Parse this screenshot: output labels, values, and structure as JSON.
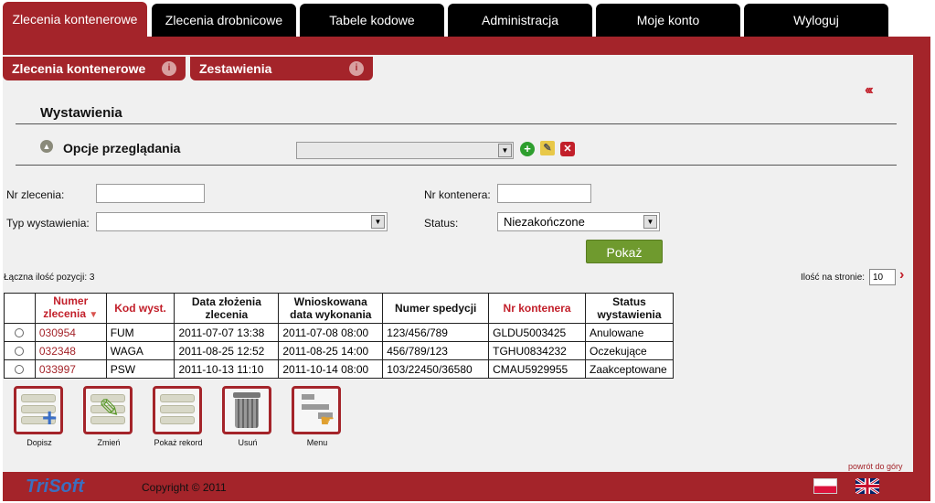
{
  "top_tabs": [
    {
      "label": "Zlecenia kontenerowe"
    },
    {
      "label": "Zlecenia drobnicowe"
    },
    {
      "label": "Tabele kodowe"
    },
    {
      "label": "Administracja"
    },
    {
      "label": "Moje konto"
    },
    {
      "label": "Wyloguj"
    }
  ],
  "sub_tabs": [
    {
      "label": "Zlecenia kontenerowe"
    },
    {
      "label": "Zestawienia"
    }
  ],
  "section_title": "Wystawienia",
  "options": {
    "label": "Opcje przeglądania",
    "selected": ""
  },
  "filters": {
    "nr_zlecenia_label": "Nr zlecenia:",
    "nr_zlecenia_value": "",
    "typ_label": "Typ wystawienia:",
    "typ_value": "",
    "nr_kontenera_label": "Nr kontenera:",
    "nr_kontenera_value": "",
    "status_label": "Status:",
    "status_value": "Niezakończone",
    "show_button": "Pokaż"
  },
  "list": {
    "count_text": "Łączna ilość pozycji: 3",
    "per_page_label": "Ilość na stronie:",
    "per_page_value": "10"
  },
  "table": {
    "headers": [
      "Numer zlecenia",
      "Kod wyst.",
      "Data złożenia zlecenia",
      "Wnioskowana data wykonania",
      "Numer spedycji",
      "Nr kontenera",
      "Status wystawienia"
    ],
    "rows": [
      [
        "030954",
        "FUM",
        "2011-07-07 13:38",
        "2011-07-08 08:00",
        "123/456/789",
        "GLDU5003425",
        "Anulowane"
      ],
      [
        "032348",
        "WAGA",
        "2011-08-25 12:52",
        "2011-08-25 14:00",
        "456/789/123",
        "TGHU0834232",
        "Oczekujące"
      ],
      [
        "033997",
        "PSW",
        "2011-10-13 11:10",
        "2011-10-14 08:00",
        "103/22450/36580",
        "CMAU5929955",
        "Zaakceptowane"
      ]
    ]
  },
  "actions": [
    {
      "label": "Dopisz"
    },
    {
      "label": "Zmień"
    },
    {
      "label": "Pokaż rekord"
    },
    {
      "label": "Usuń"
    },
    {
      "label": "Menu"
    }
  ],
  "footer": {
    "back_to_top": "powrót do góry",
    "logo": "TriSoft",
    "copyright": "Copyright © 2011"
  },
  "colors": {
    "brand": "#a4242a",
    "accent_green": "#6f9a2e",
    "link_red": "#c21f2a"
  }
}
